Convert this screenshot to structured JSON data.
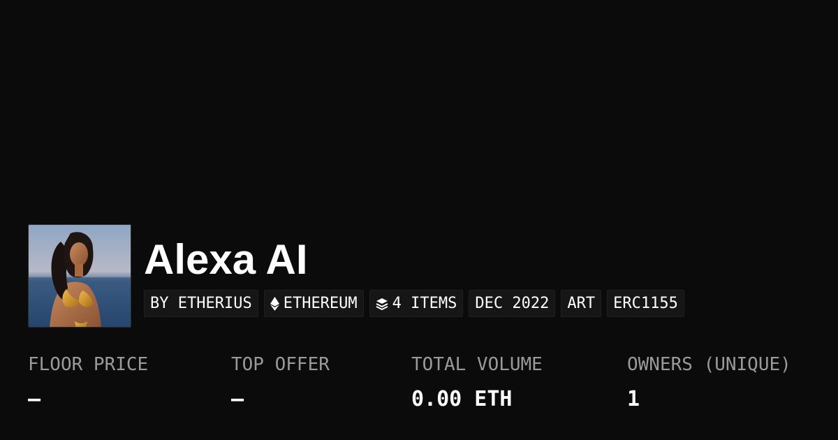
{
  "collection": {
    "title": "Alexa AI",
    "avatar_alt": "collection-avatar",
    "tags": [
      {
        "label": "BY ETHERIUS",
        "icon": ""
      },
      {
        "label": "ETHEREUM",
        "icon": "ethereum-icon"
      },
      {
        "label": "4 ITEMS",
        "icon": "layers-icon"
      },
      {
        "label": "DEC 2022",
        "icon": ""
      },
      {
        "label": "ART",
        "icon": ""
      },
      {
        "label": "ERC1155",
        "icon": ""
      }
    ]
  },
  "stats": [
    {
      "label": "FLOOR PRICE",
      "value": "–"
    },
    {
      "label": "TOP OFFER",
      "value": "–"
    },
    {
      "label": "TOTAL VOLUME",
      "value": "0.00 ETH"
    },
    {
      "label": "OWNERS (UNIQUE)",
      "value": "1"
    }
  ],
  "colors": {
    "background": "#0b0b0b",
    "tag_background": "#161616",
    "label_gray": "#9a9a9a",
    "text": "#ffffff"
  }
}
